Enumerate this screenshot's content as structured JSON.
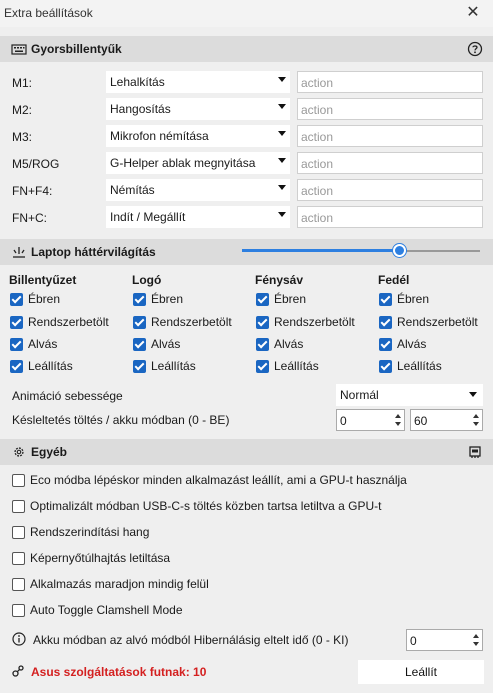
{
  "window": {
    "title": "Extra beállítások",
    "close_glyph": "✕"
  },
  "shortcuts": {
    "title": "Gyorsbillentyűk",
    "icon": "keyboard-icon",
    "help_icon": "help-icon",
    "rows": [
      {
        "label": "M1:",
        "value": "Lehalkítás",
        "placeholder": "action"
      },
      {
        "label": "M2:",
        "value": "Hangosítás",
        "placeholder": "action"
      },
      {
        "label": "M3:",
        "value": "Mikrofon némítása",
        "placeholder": "action"
      },
      {
        "label": "M5/ROG",
        "value": "G-Helper ablak megnyitása",
        "placeholder": "action"
      },
      {
        "label": "FN+F4:",
        "value": "Némítás",
        "placeholder": "action"
      },
      {
        "label": "FN+C:",
        "value": "Indít / Megállít",
        "placeholder": "action"
      }
    ]
  },
  "backlight": {
    "title": "Laptop háttérvilágítás",
    "icon": "backlight-icon",
    "brightness_fraction": 0.66,
    "columns": [
      {
        "title": "Billentyűzet",
        "items": [
          {
            "label": "Ébren",
            "checked": true
          },
          {
            "label": "Rendszerbetölt",
            "checked": true
          },
          {
            "label": "Alvás",
            "checked": true
          },
          {
            "label": "Leállítás",
            "checked": true
          }
        ]
      },
      {
        "title": "Logó",
        "items": [
          {
            "label": "Ébren",
            "checked": true
          },
          {
            "label": "Rendszerbetölt",
            "checked": true
          },
          {
            "label": "Alvás",
            "checked": true
          },
          {
            "label": "Leállítás",
            "checked": true
          }
        ]
      },
      {
        "title": "Fénysáv",
        "items": [
          {
            "label": "Ébren",
            "checked": true
          },
          {
            "label": "Rendszerbetölt",
            "checked": true
          },
          {
            "label": "Alvás",
            "checked": true
          },
          {
            "label": "Leállítás",
            "checked": true
          }
        ]
      },
      {
        "title": "Fedél",
        "items": [
          {
            "label": "Ébren",
            "checked": true
          },
          {
            "label": "Rendszerbetölt",
            "checked": true
          },
          {
            "label": "Alvás",
            "checked": true
          },
          {
            "label": "Leállítás",
            "checked": true
          }
        ]
      }
    ],
    "animation_label": "Animáció sebessége",
    "animation_value": "Normál",
    "timeout_label": "Késleltetés töltés / akku módban (0 - BE)",
    "timeout_charging": "0",
    "timeout_battery": "60"
  },
  "other": {
    "title": "Egyéb",
    "icon": "gear-icon",
    "right_icon": "ram-icon",
    "options": [
      {
        "label": "Eco módba lépéskor minden alkalmazást leállít, ami a GPU-t használja",
        "checked": false
      },
      {
        "label": "Optimalizált módban USB-C-s töltés közben tartsa letiltva a GPU-t",
        "checked": false
      },
      {
        "label": "Rendszerindítási hang",
        "checked": false
      },
      {
        "label": "Képernyőtúlhajtás letiltása",
        "checked": false
      },
      {
        "label": "Alkalmazás maradjon mindig felül",
        "checked": false
      },
      {
        "label": "Auto Toggle Clamshell Mode",
        "checked": false
      }
    ],
    "hibernate_label": "Akku módban az alvó módból Hibernálásig eltelt idő (0 - KI)",
    "hibernate_value": "0"
  },
  "footer": {
    "status": "Asus szolgáltatások futnak:  10",
    "stop_label": "Leállít"
  },
  "colors": {
    "accent": "#1a66c2",
    "slider": "#2d7fe0",
    "status": "#d42020"
  }
}
